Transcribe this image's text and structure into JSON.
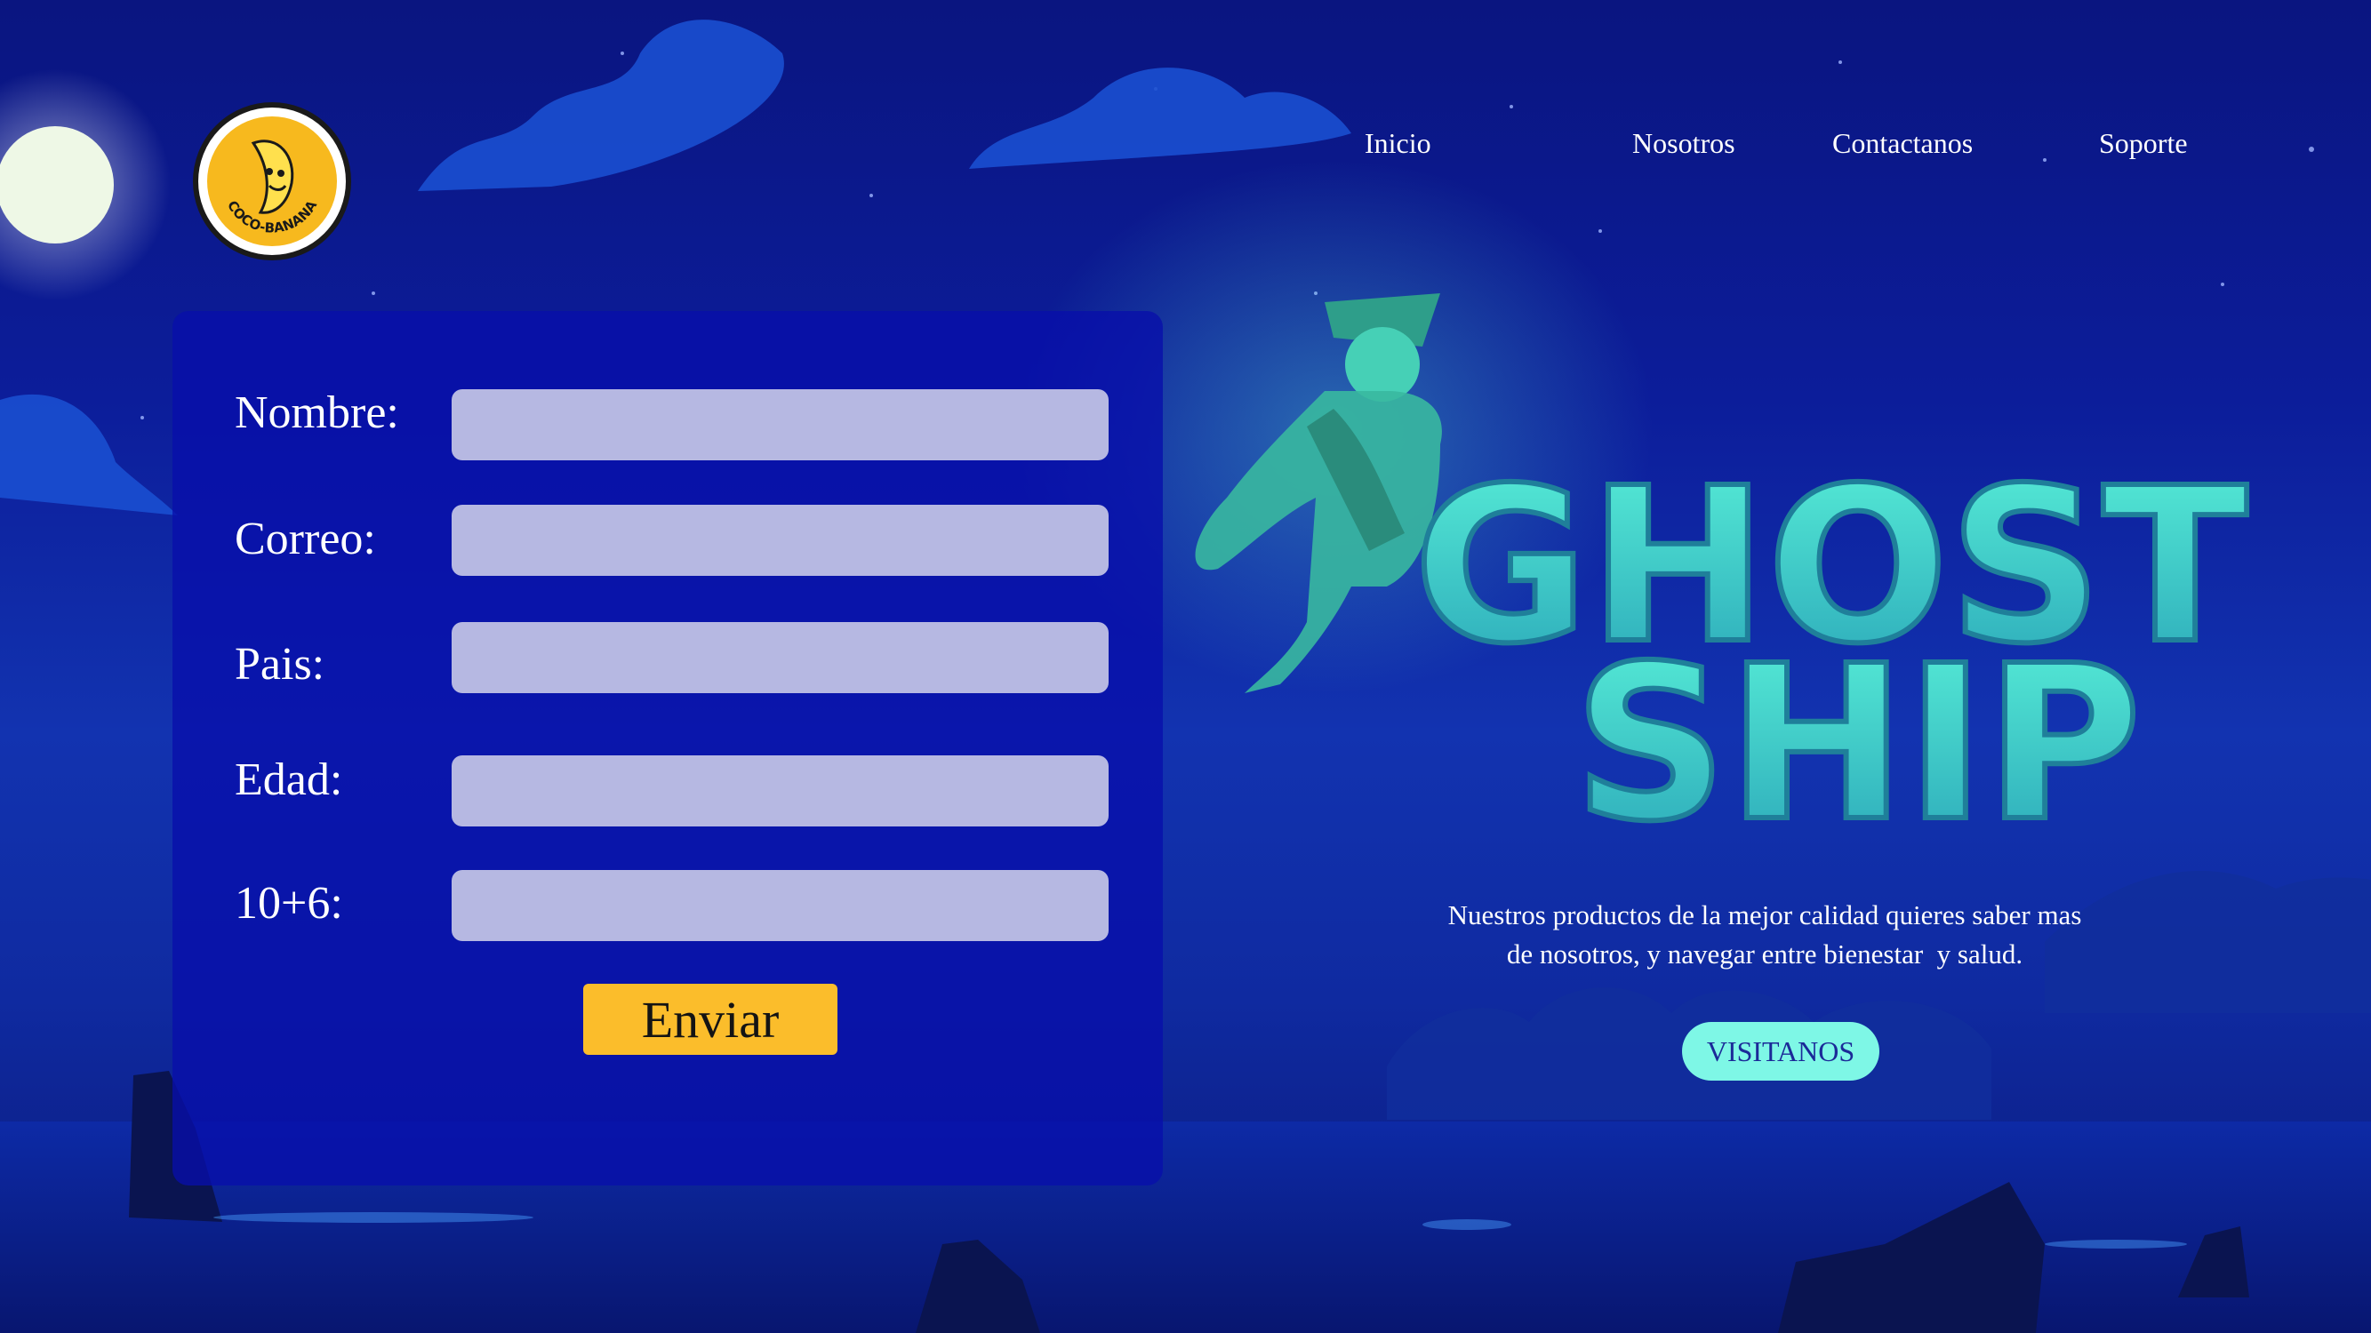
{
  "brand": {
    "logo_text": "COCO-BANANA"
  },
  "nav": {
    "items": [
      {
        "label": "Inicio"
      },
      {
        "label": "Nosotros"
      },
      {
        "label": "Contactanos"
      },
      {
        "label": "Soporte"
      }
    ]
  },
  "form": {
    "fields": [
      {
        "label": "Nombre:",
        "value": ""
      },
      {
        "label": "Correo:",
        "value": ""
      },
      {
        "label": "Pais:",
        "value": ""
      },
      {
        "label": "Edad:",
        "value": ""
      },
      {
        "label": "10+6:",
        "value": ""
      }
    ],
    "submit_label": "Enviar"
  },
  "hero": {
    "title_line1": "GHOST",
    "title_line2": "SHIP",
    "tagline_line1": "Nuestros productos de la mejor calidad quieres saber mas",
    "tagline_line2": "de nosotros, y navegar entre bienestar  y salud.",
    "cta_label": "VISITANOS"
  },
  "colors": {
    "background": "#0c1d9a",
    "panel": "#0a10b0",
    "input": "#b6b8e2",
    "submit": "#fbbd2b",
    "cta": "#7ef7e6",
    "ghost": "#3fe0c8",
    "moon": "#eef8e6"
  },
  "icons": {
    "logo": "banana-mascot-icon",
    "moon": "moon-icon",
    "ghost": "ghost-pirate-icon"
  }
}
